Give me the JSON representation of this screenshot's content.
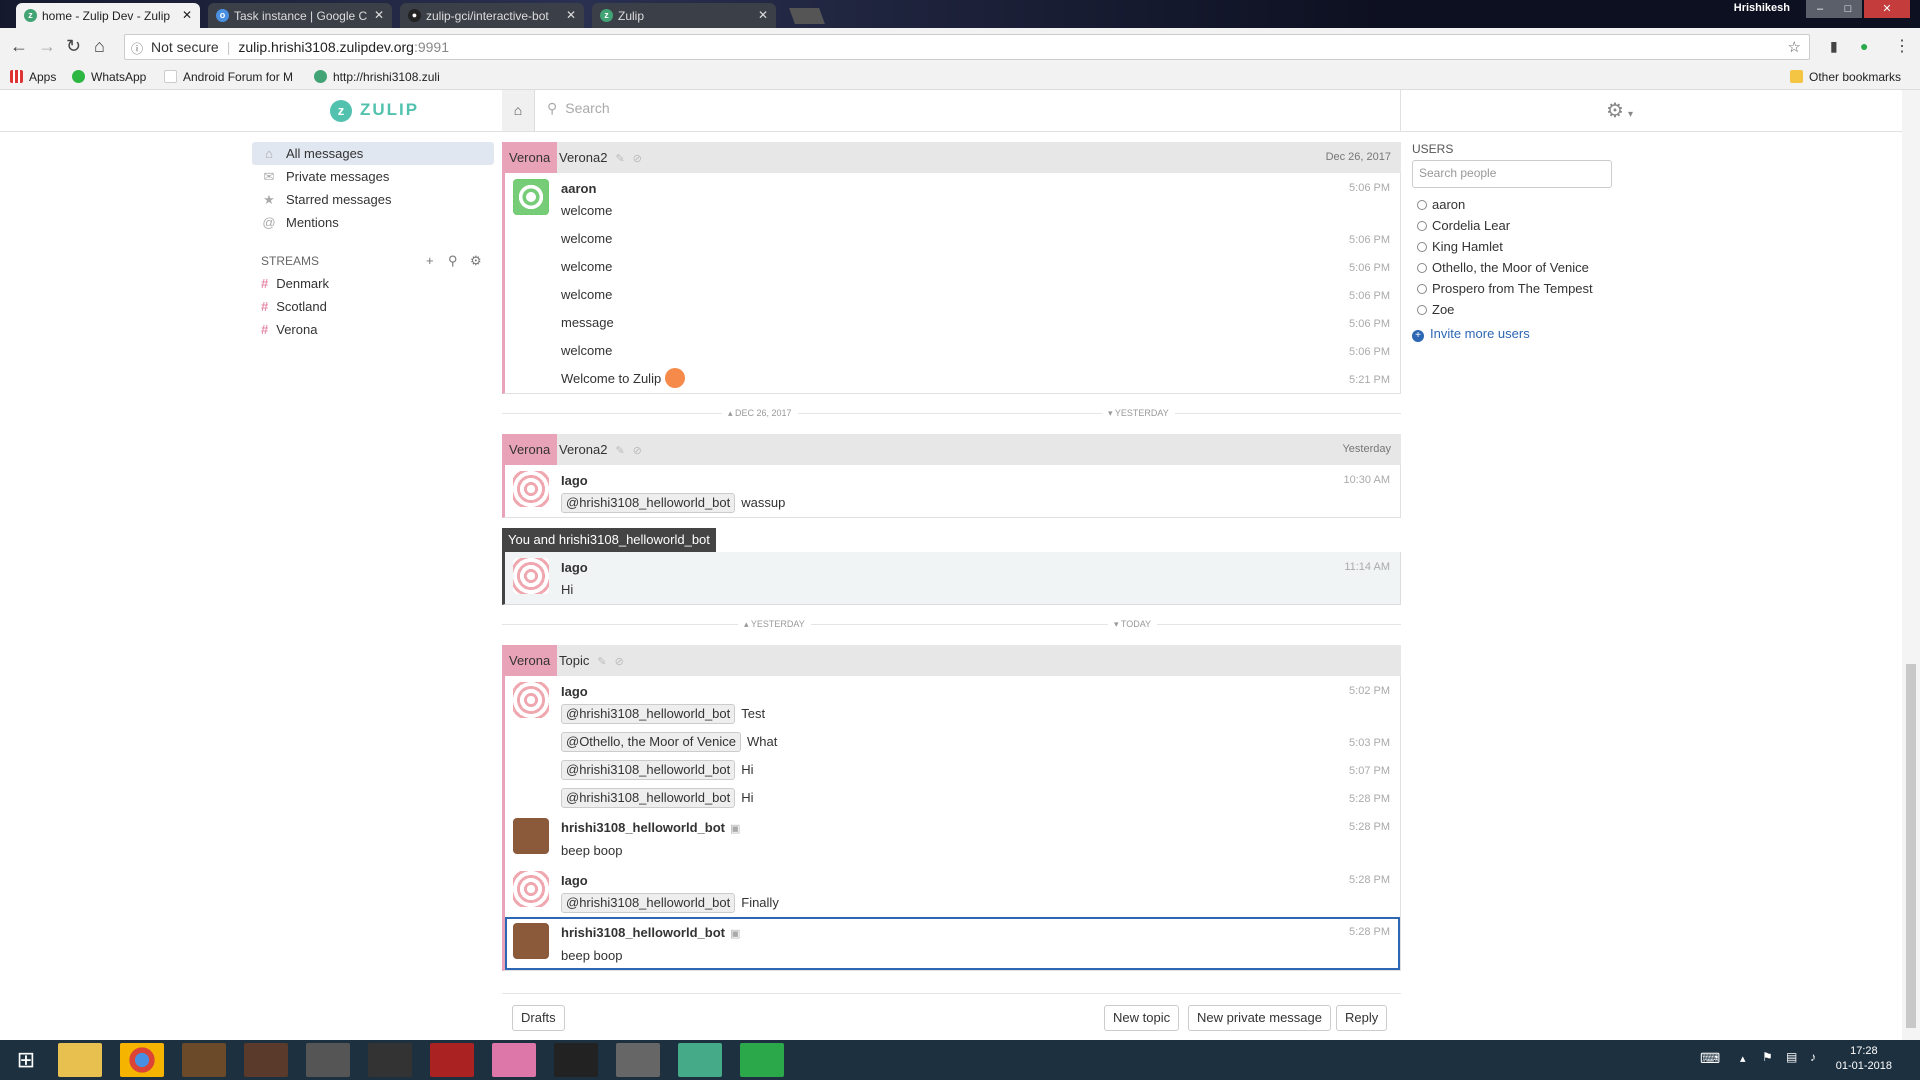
{
  "browser": {
    "tabs": [
      {
        "title": "home - Zulip Dev - Zulip",
        "active": true
      },
      {
        "title": "Task instance | Google C",
        "active": false
      },
      {
        "title": "zulip-gci/interactive-bot",
        "active": false
      },
      {
        "title": "Zulip",
        "active": false
      }
    ],
    "user": "Hrishikesh",
    "security": "Not secure",
    "url_host": "zulip.hrishi3108.zulipdev.org",
    "url_port": ":9991",
    "bookmarks": [
      "Apps",
      "WhatsApp",
      "Android Forum for M",
      "http://hrishi3108.zuli"
    ],
    "other_bookmarks": "Other bookmarks"
  },
  "zulip": {
    "logo": "ZULIP",
    "search_placeholder": "Search",
    "left": {
      "items": [
        "All messages",
        "Private messages",
        "Starred messages",
        "Mentions"
      ],
      "streams_label": "STREAMS",
      "streams": [
        "Denmark",
        "Scotland",
        "Verona"
      ]
    },
    "right": {
      "users_label": "USERS",
      "search_placeholder": "Search people",
      "users": [
        "aaron",
        "Cordelia Lear",
        "King Hamlet",
        "Othello, the Moor of Venice",
        "Prospero from The Tempest",
        "Zoe"
      ],
      "invite": "Invite more users"
    },
    "feed": {
      "g1": {
        "stream": "Verona",
        "topic": "Verona2",
        "date": "Dec 26, 2017",
        "sender": "aaron",
        "msgs": [
          {
            "t": "welcome",
            "time": "5:06 PM"
          },
          {
            "t": "welcome",
            "time": "5:06 PM"
          },
          {
            "t": "welcome",
            "time": "5:06 PM"
          },
          {
            "t": "welcome",
            "time": "5:06 PM"
          },
          {
            "t": "message",
            "time": "5:06 PM"
          },
          {
            "t": "welcome",
            "time": "5:06 PM"
          },
          {
            "t": "Welcome to Zulip",
            "time": "5:21 PM"
          }
        ]
      },
      "sep1": {
        "left": "DEC 26, 2017",
        "right": "YESTERDAY"
      },
      "g2": {
        "stream": "Verona",
        "topic": "Verona2",
        "date": "Yesterday",
        "sender": "Iago",
        "mention": "@hrishi3108_helloworld_bot",
        "text": "wassup",
        "time": "10:30 AM"
      },
      "g3": {
        "header": "You and hrishi3108_helloworld_bot",
        "sender": "Iago",
        "text": "Hi",
        "time": "11:14 AM"
      },
      "sep2": {
        "left": "YESTERDAY",
        "right": "TODAY"
      },
      "g4": {
        "stream": "Verona",
        "topic": "Topic",
        "m1": {
          "sender": "Iago",
          "mention": "@hrishi3108_helloworld_bot",
          "text": "Test",
          "time": "5:02 PM"
        },
        "m2": {
          "mention": "@Othello, the Moor of Venice",
          "text": "What",
          "time": "5:03 PM"
        },
        "m3": {
          "mention": "@hrishi3108_helloworld_bot",
          "text": "Hi",
          "time": "5:07 PM"
        },
        "m4": {
          "mention": "@hrishi3108_helloworld_bot",
          "text": "Hi",
          "time": "5:28 PM"
        },
        "m5": {
          "sender": "hrishi3108_helloworld_bot",
          "text": "beep boop",
          "time": "5:28 PM"
        },
        "m6": {
          "sender": "Iago",
          "mention": "@hrishi3108_helloworld_bot",
          "text": "Finally",
          "time": "5:28 PM"
        },
        "m7": {
          "sender": "hrishi3108_helloworld_bot",
          "text": "beep boop",
          "time": "5:28 PM"
        }
      }
    },
    "compose": {
      "drafts": "Drafts",
      "new_topic": "New topic",
      "new_pm": "New private message",
      "reply": "Reply"
    }
  },
  "taskbar": {
    "time": "17:28",
    "date": "01-01-2018"
  }
}
